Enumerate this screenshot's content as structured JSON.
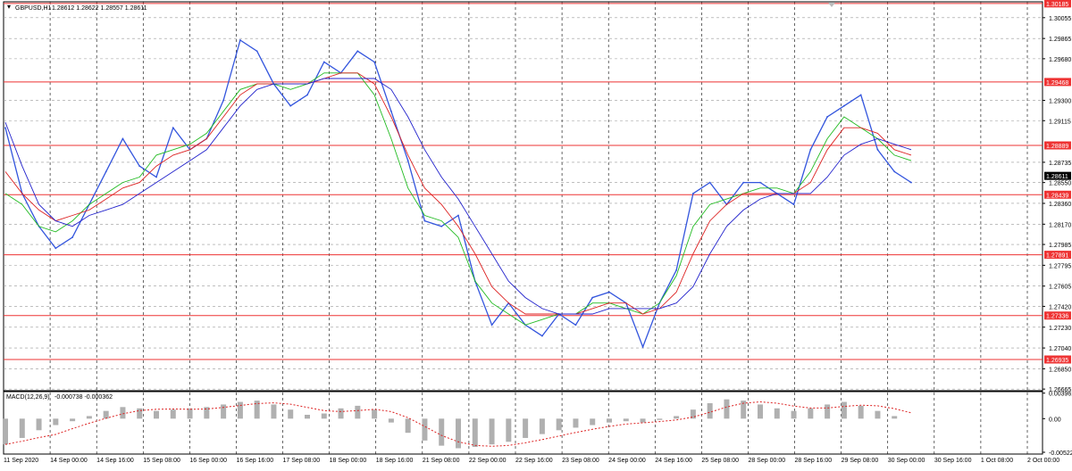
{
  "header": {
    "symbol": "GBPUSD,H1",
    "ohlc": "1.28612 1.28622 1.28557 1.28611"
  },
  "macd": {
    "label": "MACD(12,26,9)",
    "values": "-0.000738 -0.000362"
  },
  "price_axis": {
    "ticks": [
      "1.30055",
      "1.29865",
      "1.29680",
      "1.29300",
      "1.29115",
      "1.28735",
      "1.28550",
      "1.28360",
      "1.28170",
      "1.27985",
      "1.27795",
      "1.27605",
      "1.27420",
      "1.27230",
      "1.27040",
      "1.26850",
      "1.26665"
    ],
    "current_price": "1.28611",
    "ylim": [
      1.2665,
      1.302
    ]
  },
  "macd_axis": {
    "ticks": [
      "0.003961",
      "0.00",
      "-0.005222"
    ],
    "ylim": [
      -0.0055,
      0.0042
    ]
  },
  "hlines": [
    {
      "label": "1.30185",
      "value": 1.30185
    },
    {
      "label": "1.29468",
      "value": 1.29468
    },
    {
      "label": "1.28889",
      "value": 1.28889
    },
    {
      "label": "1.28439",
      "value": 1.28439
    },
    {
      "label": "1.27891",
      "value": 1.27891
    },
    {
      "label": "1.27336",
      "value": 1.27336
    },
    {
      "label": "1.26935",
      "value": 1.26935
    }
  ],
  "time_labels": [
    "11 Sep 2020",
    "14 Sep 00:00",
    "14 Sep 16:00",
    "15 Sep 08:00",
    "16 Sep 00:00",
    "16 Sep 16:00",
    "17 Sep 08:00",
    "18 Sep 00:00",
    "18 Sep 16:00",
    "21 Sep 08:00",
    "22 Sep 00:00",
    "22 Sep 16:00",
    "23 Sep 08:00",
    "24 Sep 00:00",
    "24 Sep 16:00",
    "25 Sep 08:00",
    "28 Sep 00:00",
    "28 Sep 16:00",
    "29 Sep 08:00",
    "30 Sep 00:00",
    "30 Sep 16:00",
    "1 Oct 08:00",
    "2 Oct 00:00"
  ],
  "colors": {
    "price_line": "#3355dd",
    "ma_fast": "#22bb22",
    "ma_mid": "#dd2222",
    "ma_slow": "#2222cc",
    "hline": "#ee3333",
    "grid": "#999999",
    "macd_hist": "#b0b0b0",
    "macd_signal": "#dd2222"
  },
  "chart_data": {
    "type": "line",
    "title": "GBPUSD,H1",
    "ylim": [
      1.2665,
      1.302
    ],
    "x_ticks": [
      "11 Sep 2020",
      "14 Sep 00:00",
      "14 Sep 16:00",
      "15 Sep 08:00",
      "16 Sep 00:00",
      "16 Sep 16:00",
      "17 Sep 08:00",
      "18 Sep 00:00",
      "18 Sep 16:00",
      "21 Sep 08:00",
      "22 Sep 00:00",
      "22 Sep 16:00",
      "23 Sep 08:00",
      "24 Sep 00:00",
      "24 Sep 16:00",
      "25 Sep 08:00",
      "28 Sep 00:00",
      "28 Sep 16:00",
      "29 Sep 08:00",
      "30 Sep 00:00",
      "30 Sep 16:00",
      "1 Oct 08:00",
      "2 Oct 00:00"
    ],
    "grid": true,
    "series": [
      {
        "name": "GBPUSD,H1",
        "values": [
          1.2905,
          1.2845,
          1.2815,
          1.2795,
          1.2805,
          1.2835,
          1.2865,
          1.2895,
          1.287,
          1.286,
          1.2905,
          1.2885,
          1.2895,
          1.293,
          1.2985,
          1.2975,
          1.2945,
          1.2925,
          1.2935,
          1.2965,
          1.2955,
          1.2975,
          1.2965,
          1.292,
          1.2875,
          1.282,
          1.2815,
          1.2825,
          1.2765,
          1.2725,
          1.2745,
          1.2725,
          1.2715,
          1.2735,
          1.2725,
          1.275,
          1.2755,
          1.2745,
          1.2705,
          1.2745,
          1.2775,
          1.2845,
          1.2855,
          1.2835,
          1.2855,
          1.2855,
          1.2845,
          1.2835,
          1.2885,
          1.2915,
          1.2925,
          1.2935,
          1.2885,
          1.2865,
          1.2855
        ]
      },
      {
        "values": [
          1.2845,
          1.2835,
          1.2815,
          1.281,
          1.282,
          1.2835,
          1.2845,
          1.2855,
          1.286,
          1.288,
          1.2885,
          1.289,
          1.29,
          1.292,
          1.294,
          1.2945,
          1.2945,
          1.294,
          1.2945,
          1.2955,
          1.2955,
          1.2955,
          1.2935,
          1.2895,
          1.285,
          1.2825,
          1.282,
          1.2805,
          1.2765,
          1.2745,
          1.2735,
          1.2725,
          1.273,
          1.2735,
          1.2735,
          1.2745,
          1.2745,
          1.274,
          1.2735,
          1.2745,
          1.277,
          1.2815,
          1.2835,
          1.284,
          1.2845,
          1.285,
          1.285,
          1.2845,
          1.2865,
          1.2895,
          1.2915,
          1.2905,
          1.2895,
          1.288,
          1.2875
        ]
      },
      {
        "values": [
          1.2865,
          1.2845,
          1.283,
          1.282,
          1.2825,
          1.283,
          1.284,
          1.285,
          1.2855,
          1.287,
          1.288,
          1.2885,
          1.2895,
          1.2915,
          1.2935,
          1.2945,
          1.2945,
          1.2945,
          1.2945,
          1.295,
          1.2955,
          1.2955,
          1.2945,
          1.2915,
          1.288,
          1.285,
          1.2835,
          1.2815,
          1.279,
          1.276,
          1.2745,
          1.2735,
          1.2735,
          1.2735,
          1.2735,
          1.274,
          1.2745,
          1.2745,
          1.2735,
          1.274,
          1.2755,
          1.279,
          1.282,
          1.2835,
          1.2845,
          1.2845,
          1.2845,
          1.2845,
          1.2855,
          1.2885,
          1.2905,
          1.2905,
          1.29,
          1.2885,
          1.288
        ]
      },
      {
        "values": [
          1.291,
          1.287,
          1.2835,
          1.282,
          1.2815,
          1.2825,
          1.283,
          1.2835,
          1.2845,
          1.2855,
          1.2865,
          1.2875,
          1.2885,
          1.2905,
          1.2925,
          1.294,
          1.2945,
          1.2945,
          1.2945,
          1.295,
          1.295,
          1.295,
          1.295,
          1.294,
          1.2915,
          1.2885,
          1.286,
          1.284,
          1.2815,
          1.279,
          1.2765,
          1.275,
          1.274,
          1.2735,
          1.2735,
          1.2735,
          1.274,
          1.274,
          1.274,
          1.274,
          1.2745,
          1.276,
          1.279,
          1.2815,
          1.283,
          1.284,
          1.2845,
          1.2845,
          1.2845,
          1.286,
          1.288,
          1.289,
          1.2895,
          1.289,
          1.2885
        ]
      }
    ],
    "macd_histogram": [
      -0.004,
      -0.003,
      -0.0018,
      -0.001,
      -0.0004,
      0.0004,
      0.0012,
      0.0018,
      0.0016,
      0.0012,
      0.0014,
      0.0016,
      0.0018,
      0.0022,
      0.0026,
      0.0028,
      0.0022,
      0.0014,
      0.0006,
      0.0008,
      0.0016,
      0.002,
      0.0014,
      -0.0006,
      -0.0022,
      -0.0034,
      -0.0042,
      -0.0046,
      -0.0044,
      -0.004,
      -0.0036,
      -0.003,
      -0.0024,
      -0.0018,
      -0.0014,
      -0.001,
      -0.0006,
      -0.0004,
      -0.0006,
      -0.0002,
      0.0004,
      0.0014,
      0.0024,
      0.003,
      0.0028,
      0.0022,
      0.0016,
      0.0012,
      0.0016,
      0.0022,
      0.0026,
      0.002,
      0.0012,
      0.0004,
      0.0
    ]
  }
}
